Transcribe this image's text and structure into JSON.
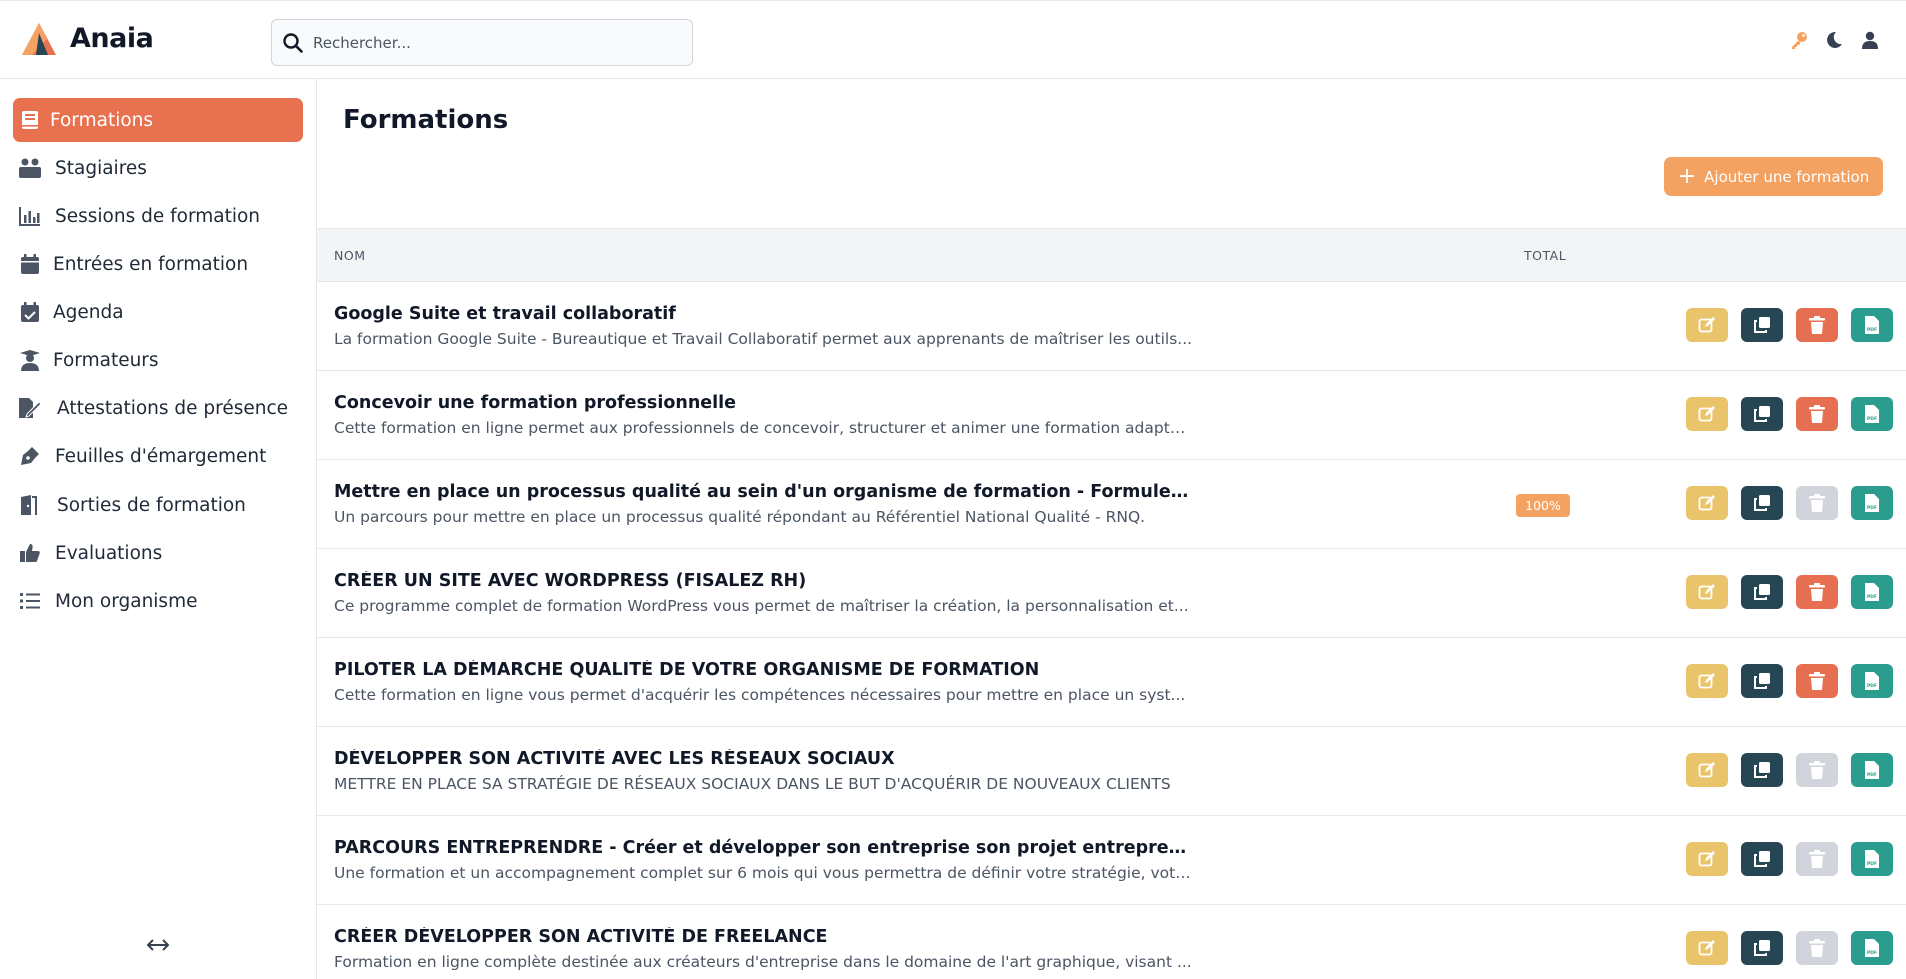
{
  "app": {
    "brand": "Anaia"
  },
  "search": {
    "placeholder": "Rechercher..."
  },
  "sidebar": {
    "items": [
      {
        "label": "Formations",
        "icon": "book-icon",
        "active": true
      },
      {
        "label": "Stagiaires",
        "icon": "users-icon"
      },
      {
        "label": "Sessions de formation",
        "icon": "bar-chart-icon"
      },
      {
        "label": "Entrées en formation",
        "icon": "calendar-icon"
      },
      {
        "label": "Agenda",
        "icon": "calendar-check-icon"
      },
      {
        "label": "Formateurs",
        "icon": "teacher-icon"
      },
      {
        "label": "Attestations de présence",
        "icon": "file-signature-icon"
      },
      {
        "label": "Feuilles d'émargement",
        "icon": "pen-nib-icon"
      },
      {
        "label": "Sorties de formation",
        "icon": "door-exit-icon"
      },
      {
        "label": "Evaluations",
        "icon": "thumbs-up-icon"
      },
      {
        "label": "Mon organisme",
        "icon": "list-icon"
      }
    ]
  },
  "main": {
    "title": "Formations",
    "add_button_label": "Ajouter une formation",
    "columns": {
      "name": "NOM",
      "total": "TOTAL"
    },
    "rows": [
      {
        "name": "Google Suite et travail collaboratif",
        "description": "La formation Google Suite - Bureautique et Travail Collaboratif permet aux apprenants de maîtriser les outils...",
        "badge": "",
        "delete_enabled": true
      },
      {
        "name": "Concevoir une formation professionnelle",
        "description": "Cette formation en ligne permet aux professionnels de concevoir, structurer et animer une formation adapté...",
        "badge": "",
        "delete_enabled": true
      },
      {
        "name": "Mettre en place un processus qualité au sein d'un organisme de formation - Formule E-LEAR...",
        "description": "Un parcours pour mettre en place un processus qualité répondant au Référentiel National Qualité - RNQ.",
        "badge": "100%",
        "delete_enabled": false
      },
      {
        "name": "CRÉER UN SITE AVEC WORDPRESS (FISALEZ RH)",
        "description": "Ce programme complet de formation WordPress vous permet de maîtriser la création, la personnalisation et...",
        "badge": "",
        "delete_enabled": true
      },
      {
        "name": "PILOTER LA DÉMARCHE QUALITÉ DE VOTRE ORGANISME DE FORMATION",
        "description": "Cette formation en ligne vous permet d'acquérir les compétences nécessaires pour mettre en place un syst...",
        "badge": "",
        "delete_enabled": true
      },
      {
        "name": "DÉVELOPPER SON ACTIVITÉ AVEC LES RÉSEAUX SOCIAUX",
        "description": "METTRE EN PLACE SA STRATÉGIE DE RÉSEAUX SOCIAUX DANS LE BUT D'ACQUÉRIR DE NOUVEAUX CLIENTS",
        "badge": "",
        "delete_enabled": false
      },
      {
        "name": "PARCOURS ENTREPRENDRE - Créer et développer son entreprise son projet entrepreneurial et ...",
        "description": "Une formation et un accompagnement complet sur 6 mois qui vous permettra de définir votre stratégie, votr...",
        "badge": "",
        "delete_enabled": false
      },
      {
        "name": "CRÉER DÉVELOPPER SON ACTIVITÉ DE FREELANCE",
        "description": "Formation en ligne complète destinée aux créateurs d'entreprise dans le domaine de l'art graphique, visant ...",
        "badge": "",
        "delete_enabled": false
      }
    ]
  },
  "colors": {
    "primary": "#e8714f",
    "accent": "#f4a261",
    "edit": "#e9c46a",
    "duplicate": "#264653",
    "delete": "#e76f51",
    "pdf": "#2a9d8f",
    "disabled": "#d1d5db"
  }
}
